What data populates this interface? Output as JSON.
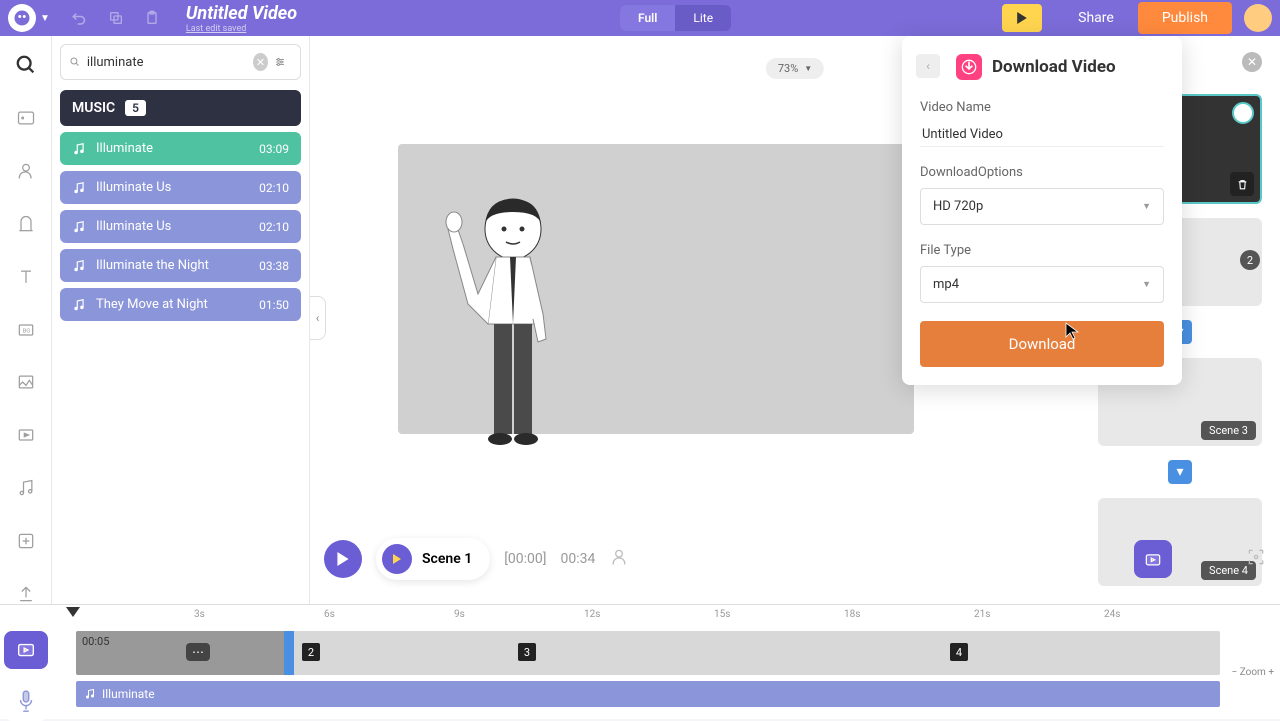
{
  "header": {
    "title": "Untitled Video",
    "subtitle": "Last edit saved",
    "mode_full": "Full",
    "mode_lite": "Lite",
    "share": "Share",
    "publish": "Publish"
  },
  "search": {
    "value": "illuminate"
  },
  "music": {
    "header": "MUSIC",
    "count": "5",
    "tracks": [
      {
        "name": "Illuminate",
        "duration": "03:09",
        "selected": true
      },
      {
        "name": "Illuminate Us",
        "duration": "02:10",
        "selected": false
      },
      {
        "name": "Illuminate Us",
        "duration": "02:10",
        "selected": false
      },
      {
        "name": "Illuminate the Night",
        "duration": "03:38",
        "selected": false
      },
      {
        "name": "They Move at Night",
        "duration": "01:50",
        "selected": false
      }
    ]
  },
  "canvas": {
    "zoom": "73%",
    "scene_label": "Scene 1",
    "time_current": "[00:00]",
    "time_total": "00:34"
  },
  "scenes": {
    "s2": "2",
    "s3": "Scene 3",
    "s4": "Scene 4"
  },
  "download": {
    "title": "Download Video",
    "name_label": "Video Name",
    "name_value": "Untitled Video",
    "options_label": "DownloadOptions",
    "options_value": "HD 720p",
    "filetype_label": "File Type",
    "filetype_value": "mp4",
    "button": "Download"
  },
  "timeline": {
    "ticks": [
      "3s",
      "6s",
      "9s",
      "12s",
      "15s",
      "18s",
      "21s",
      "24s"
    ],
    "clip_time": "00:05",
    "seg2": "2",
    "seg3": "3",
    "seg4": "4",
    "audio_name": "Illuminate",
    "zoom_label": "Zoom",
    "zoom_minus": "−",
    "zoom_plus": "+"
  }
}
